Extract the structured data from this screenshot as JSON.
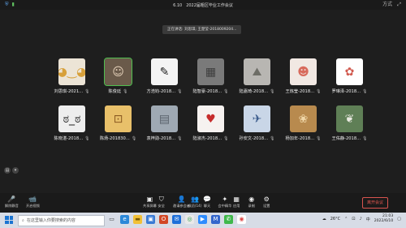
{
  "window": {
    "title": "6.10　2022届粗区毕业工作会议",
    "participants_icon": "participants-icon",
    "right_label": "方式"
  },
  "speaking_banner": "正在讲话: 刘思琪; 王楚莹-2018009204...",
  "participants": [
    {
      "name": "刘思琪-2021...",
      "mic": "mic-muted-icon",
      "color": "#ece4d6",
      "glyph": "◕‿◕",
      "glyph_color": "#d7a03a"
    },
    {
      "name": "陈俊廷",
      "mic": "mic-icon",
      "color": "#6a5a4a",
      "glyph": "☺",
      "glyph_color": "#e6d2bb",
      "active": true
    },
    {
      "name": "方浩钧-2018...",
      "mic": "mic-muted-icon",
      "color": "#f4f4f4",
      "glyph": "✎",
      "glyph_color": "#222"
    },
    {
      "name": "陆智豪-2018...",
      "mic": "mic-muted-icon",
      "color": "#7a7a7a",
      "glyph": "▦",
      "glyph_color": "#3d3d3d"
    },
    {
      "name": "陆嘉琦-2018...",
      "mic": "mic-muted-icon",
      "color": "#b8b6b2",
      "glyph": "⛰",
      "glyph_color": "#6d6d66"
    },
    {
      "name": "王炼莹-2018...",
      "mic": "mic-muted-icon",
      "color": "#f1e8e3",
      "glyph": "☻",
      "glyph_color": "#d86a5c"
    },
    {
      "name": "罗琳泽-2018...",
      "mic": "mic-muted-icon",
      "color": "#ffffff",
      "glyph": "✿",
      "glyph_color": "#d15a4f"
    },
    {
      "name": "陈晓湛-2018...",
      "mic": "mic-muted-icon",
      "color": "#eeeeee",
      "glyph": "ಠ_ಠ",
      "glyph_color": "#222"
    },
    {
      "name": "陈炀-201830...",
      "mic": "mic-muted-icon",
      "color": "#e8c06a",
      "glyph": "⊡",
      "glyph_color": "#8a5a22"
    },
    {
      "name": "袁梓勋-2018...",
      "mic": "mic-muted-icon",
      "color": "#9fa9b3",
      "glyph": "▤",
      "glyph_color": "#58606a"
    },
    {
      "name": "陆淑杰-2018...",
      "mic": "mic-muted-icon",
      "color": "#f6f2f0",
      "glyph": "♥",
      "glyph_color": "#c62c2c"
    },
    {
      "name": "孙安文-2018...",
      "mic": "mic-muted-icon",
      "color": "#c9d6e7",
      "glyph": "✈",
      "glyph_color": "#3c5c8c"
    },
    {
      "name": "杨加年-2018...",
      "mic": "mic-muted-icon",
      "color": "#b88a4e",
      "glyph": "❀",
      "glyph_color": "#f0d7a8"
    },
    {
      "name": "王佑静-2018...",
      "mic": "mic-muted-icon",
      "color": "#5f7f56",
      "glyph": "❦",
      "glyph_color": "#e9e9e0"
    }
  ],
  "chat_controls": {
    "icon1": "chat-icon",
    "icon2": "more-icon"
  },
  "toolbar": {
    "left": [
      {
        "label": "解除静音",
        "icon": "mic-off-icon",
        "glyph": "🎤"
      },
      {
        "label": "开启视频",
        "icon": "video-off-icon",
        "glyph": "📹"
      }
    ],
    "center": [
      {
        "label": "共享屏幕",
        "icon": "share-screen-icon",
        "glyph": "▣"
      },
      {
        "label": "安全",
        "icon": "shield-icon",
        "glyph": "⛉"
      },
      {
        "label": "邀请参会者",
        "icon": "invite-icon",
        "glyph": "👤"
      },
      {
        "label": "成员(14)",
        "icon": "members-icon",
        "glyph": "👥"
      },
      {
        "label": "聊天",
        "icon": "chat-icon",
        "glyph": "💬"
      },
      {
        "label": "会中精华",
        "icon": "highlight-icon",
        "glyph": "✦"
      },
      {
        "label": "应用",
        "icon": "apps-icon",
        "glyph": "▦"
      },
      {
        "label": "录制",
        "icon": "record-icon",
        "glyph": "◉"
      },
      {
        "label": "设置",
        "icon": "gear-icon",
        "glyph": "⚙"
      }
    ],
    "leave_label": "离开会议"
  },
  "taskbar": {
    "search_placeholder": "在这里输入你要搜索的内容",
    "weather": "26°C",
    "ime": "中",
    "time": "21:03",
    "date": "2022/6/10"
  }
}
